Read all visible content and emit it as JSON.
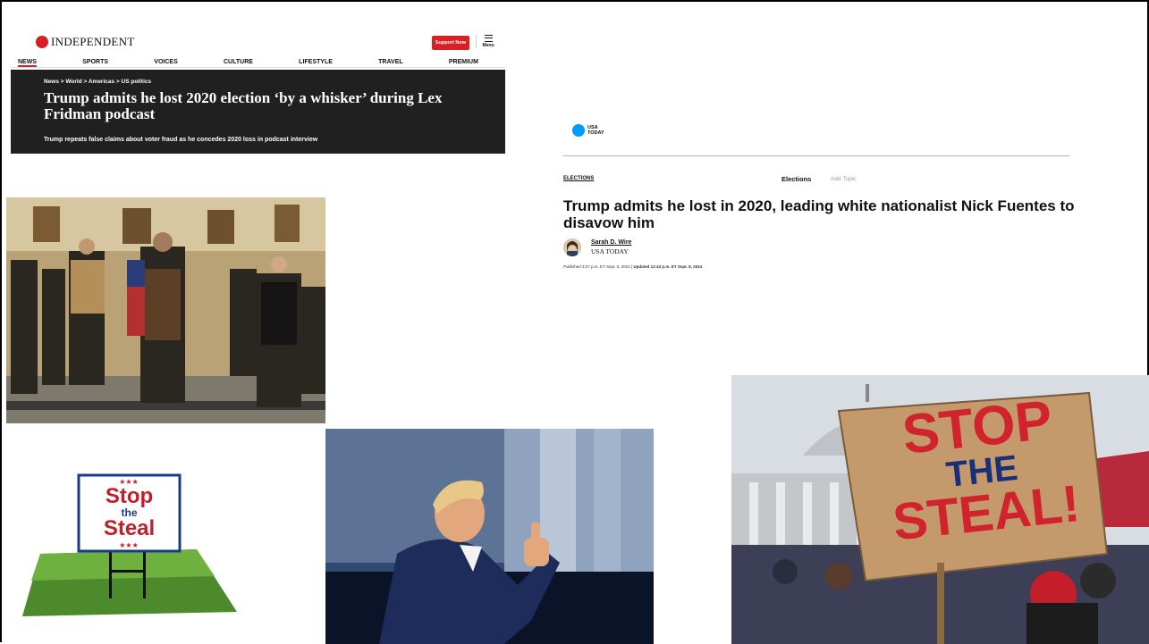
{
  "independent": {
    "logo": "INDEPENDENT",
    "support_label": "Support Now",
    "menu_label": "Menu",
    "nav": [
      "NEWS",
      "SPORTS",
      "VOICES",
      "CULTURE",
      "LIFESTYLE",
      "TRAVEL",
      "PREMIUM"
    ],
    "breadcrumb": "News > World > Americas > US politics",
    "headline": "Trump admits he lost 2020 election ‘by a whisker’ during Lex Fridman podcast",
    "subheadline": "Trump repeats false claims about voter fraud as he concedes 2020 loss in podcast interview"
  },
  "usatoday": {
    "logo_line1": "USA",
    "logo_line2": "TODAY",
    "section": "ELECTIONS",
    "topic": "Elections",
    "add_topic": "Add Topic",
    "headline": "Trump admits he lost in 2020, leading white nationalist Nick Fuentes to disavow him",
    "author": "Sarah D. Wire",
    "publication": "USA TODAY",
    "published": "Published 3:27 p.m. ET Sept. 5, 2024",
    "updated": "Updated 12:43 p.m. ET Sept. 8, 2024"
  },
  "sign": {
    "line1": "Stop",
    "line2": "the",
    "line3": "Steal"
  },
  "protest_sign": {
    "line1": "STOP",
    "line2": "THE",
    "line3": "STEAL!"
  },
  "colors": {
    "independent_red": "#d91f26",
    "usatoday_blue": "#009bff",
    "dark_band": "#202020"
  }
}
